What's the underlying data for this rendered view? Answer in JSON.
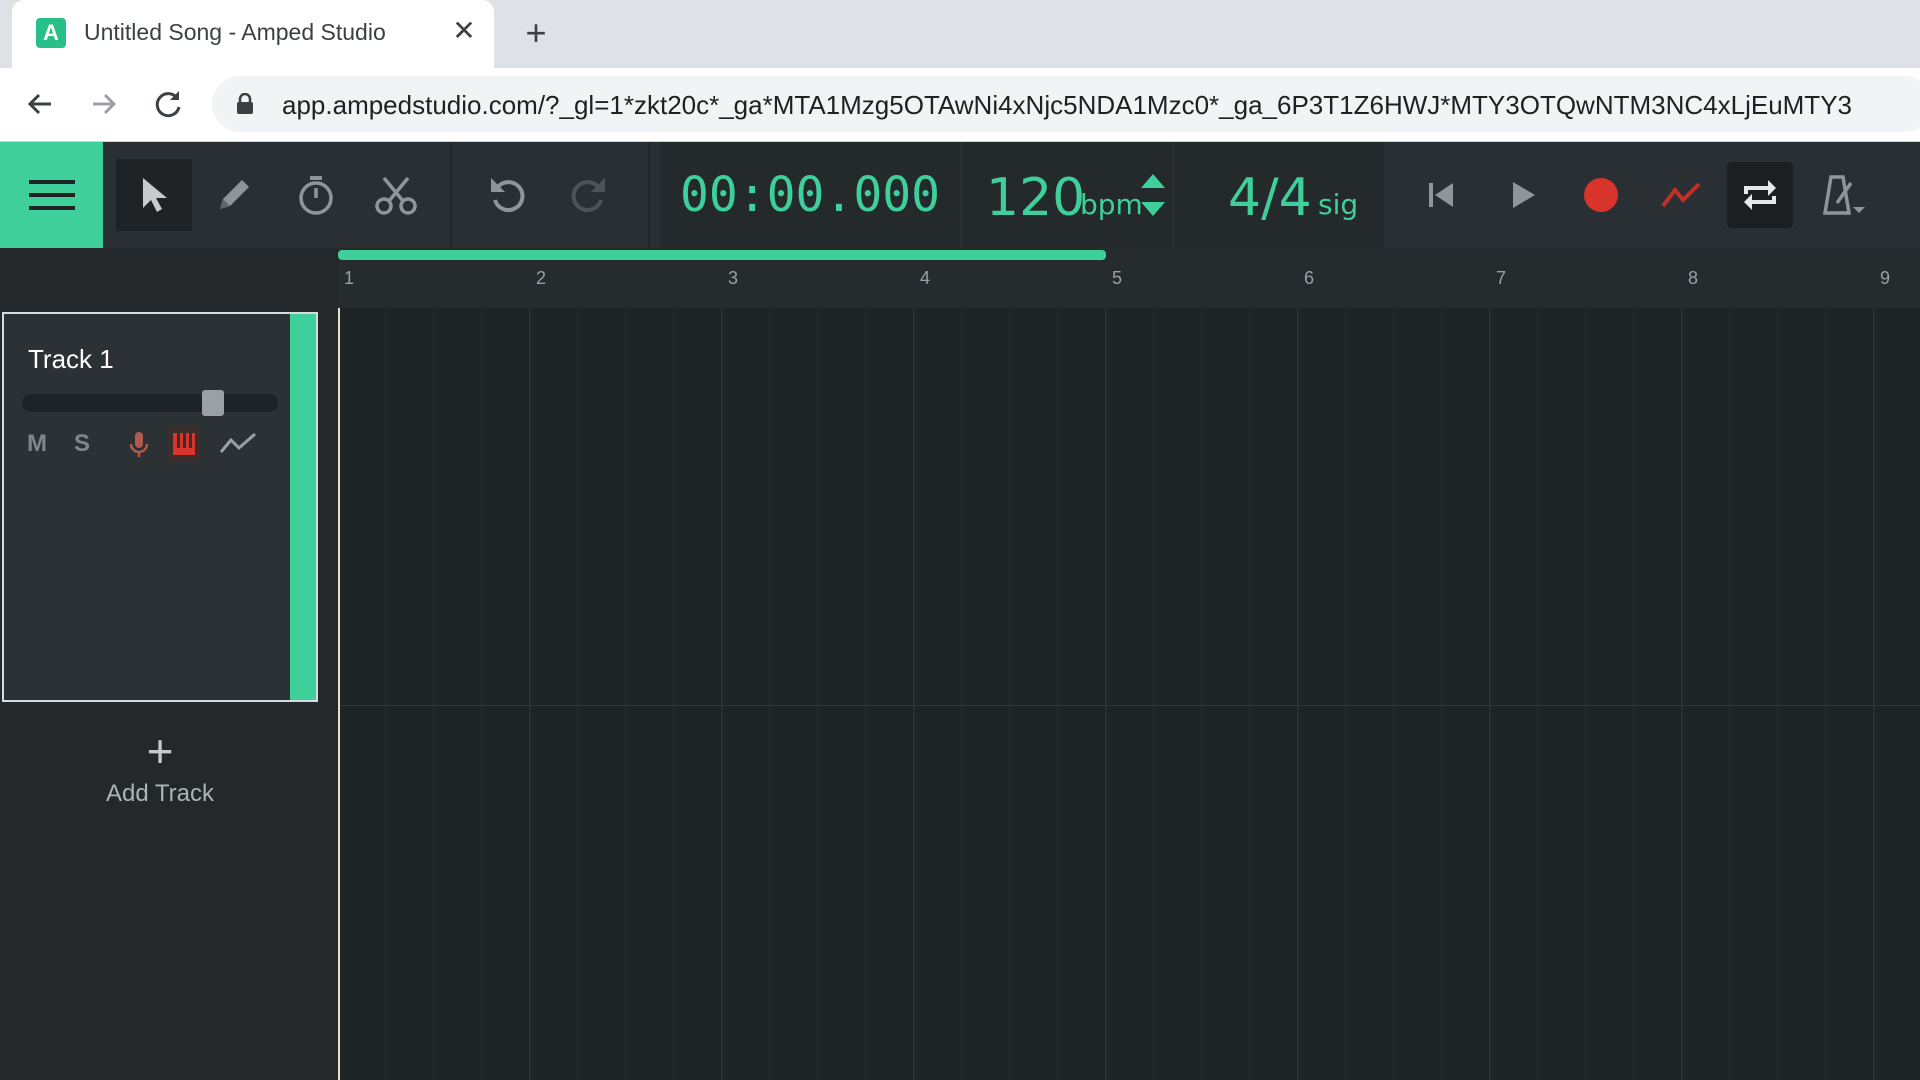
{
  "browser": {
    "tab_title": "Untitled Song - Amped Studio",
    "tab_icon": "amped-studio-logo-icon",
    "close_glyph": "✕",
    "new_tab_glyph": "+",
    "url": "app.ampedstudio.com/?_gl=1*zkt20c*_ga*MTA1Mzg5OTAwNi4xNjc5NDA1Mzc0*_ga_6P3T1Z6HWJ*MTY3OTQwNTM3NC4xLjEuMTY3"
  },
  "app": {
    "accent": "#3ecf9a",
    "time_display": "00:00.000",
    "tempo": {
      "value": "120",
      "unit": "bpm"
    },
    "signature": {
      "value": "4/4",
      "unit": "sig"
    },
    "tools": [
      "menu-icon",
      "select-pointer-icon",
      "pencil-icon",
      "stopwatch-icon",
      "scissors-icon",
      "undo-icon",
      "redo-icon"
    ],
    "transport": [
      "skip-to-start-icon",
      "play-icon",
      "record-icon",
      "automation-icon",
      "loop-icon",
      "metronome-icon"
    ]
  },
  "tracks": [
    {
      "name": "Track 1",
      "volume": 0.77,
      "buttons": {
        "mute": "M",
        "solo": "S"
      }
    }
  ],
  "add_track": {
    "plus": "+",
    "label": "Add Track"
  },
  "ruler": {
    "bars": [
      "1",
      "2",
      "3",
      "4",
      "5",
      "6",
      "7",
      "8",
      "9"
    ],
    "loop_start_bar": 1,
    "loop_end_bar": 5
  }
}
